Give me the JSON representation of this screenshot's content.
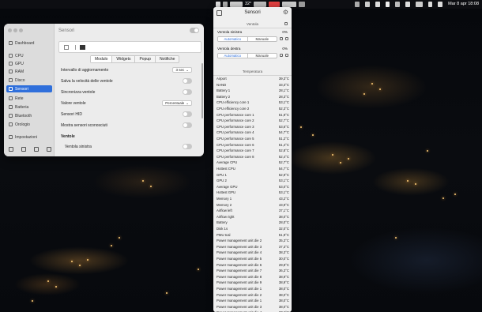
{
  "menubar": {
    "temp": "32°",
    "datetime": "Mar 8 apr  18:08"
  },
  "settings": {
    "sidebar": {
      "items": [
        {
          "label": "Dashboard",
          "icon": "dashboard-icon"
        },
        {
          "label": "CPU",
          "icon": "cpu-icon"
        },
        {
          "label": "GPU",
          "icon": "gpu-icon"
        },
        {
          "label": "RAM",
          "icon": "ram-icon"
        },
        {
          "label": "Disco",
          "icon": "disk-icon"
        },
        {
          "label": "Sensori",
          "icon": "sensor-icon"
        },
        {
          "label": "Rete",
          "icon": "network-icon"
        },
        {
          "label": "Batteria",
          "icon": "battery-icon"
        },
        {
          "label": "Bluetooth",
          "icon": "bluetooth-icon"
        },
        {
          "label": "Orologio",
          "icon": "clock-icon"
        }
      ],
      "active_index": 5,
      "settings_label": "Impostazioni"
    },
    "title": "Sensori",
    "tabs": [
      "Modulo",
      "Widgets",
      "Popup",
      "Notifiche"
    ],
    "active_tab": 0,
    "rows": [
      {
        "label": "Intervallo di aggiornamento",
        "control": "select",
        "value": "3 sec"
      },
      {
        "label": "Salva la velocità delle ventole",
        "control": "toggle"
      },
      {
        "label": "Sincronizza ventole",
        "control": "toggle"
      },
      {
        "label": "Valore ventole",
        "control": "select",
        "value": "Percentuale"
      },
      {
        "label": "Sensori HID",
        "control": "toggle"
      },
      {
        "label": "Mostra sensori sconosciuti",
        "control": "toggle"
      },
      {
        "label": "Ventole",
        "control": "none"
      },
      {
        "label": "Ventola sinistra",
        "control": "toggle"
      }
    ]
  },
  "popup": {
    "title": "Sensori",
    "fan_section": "Ventola",
    "fans": [
      {
        "name": "Ventola sinistra",
        "value": "0%",
        "mode_auto": "Automatico",
        "mode_manual": "Manuale"
      },
      {
        "name": "Ventola destra",
        "value": "0%",
        "mode_auto": "Automatico",
        "mode_manual": "Manuale"
      }
    ],
    "temp_section": "Temperatura",
    "sensors": [
      {
        "name": "Airport",
        "value": "39,3°C"
      },
      {
        "name": "NAND",
        "value": "33,3°C"
      },
      {
        "name": "Battery 1",
        "value": "28,1°C"
      },
      {
        "name": "Battery 2",
        "value": "28,3°C"
      },
      {
        "name": "CPU efficiency core 1",
        "value": "53,1°C"
      },
      {
        "name": "CPU efficiency core 2",
        "value": "52,3°C"
      },
      {
        "name": "CPU performance core 1",
        "value": "51,9°C"
      },
      {
        "name": "CPU performance core 2",
        "value": "52,7°C"
      },
      {
        "name": "CPU performance core 3",
        "value": "53,6°C"
      },
      {
        "name": "CPU performance core 4",
        "value": "54,7°C"
      },
      {
        "name": "CPU performance core 5",
        "value": "51,2°C"
      },
      {
        "name": "CPU performance core 6",
        "value": "51,4°C"
      },
      {
        "name": "CPU performance core 7",
        "value": "52,8°C"
      },
      {
        "name": "CPU performance core 8",
        "value": "52,4°C"
      },
      {
        "name": "Average CPU",
        "value": "52,7°C"
      },
      {
        "name": "Hottest CPU",
        "value": "54,7°C"
      },
      {
        "name": "GPU 1",
        "value": "52,9°C"
      },
      {
        "name": "GPU 2",
        "value": "53,1°C"
      },
      {
        "name": "Average GPU",
        "value": "53,0°C"
      },
      {
        "name": "Hottest GPU",
        "value": "53,1°C"
      },
      {
        "name": "Memory 1",
        "value": "43,2°C"
      },
      {
        "name": "Memory 2",
        "value": "43,9°C"
      },
      {
        "name": "Airflow left",
        "value": "37,1°C"
      },
      {
        "name": "Airflow right",
        "value": "38,0°C"
      },
      {
        "name": "Battery",
        "value": "28,0°C"
      },
      {
        "name": "Disk 1s",
        "value": "32,0°C"
      },
      {
        "name": "PMU tcal",
        "value": "51,9°C"
      },
      {
        "name": "Power management unit die 2",
        "value": "35,3°C"
      },
      {
        "name": "Power management unit die 3",
        "value": "37,3°C"
      },
      {
        "name": "Power management unit die 4",
        "value": "38,3°C"
      },
      {
        "name": "Power management unit die 5",
        "value": "30,0°C"
      },
      {
        "name": "Power management unit die 6",
        "value": "29,8°C"
      },
      {
        "name": "Power management unit die 7",
        "value": "36,3°C"
      },
      {
        "name": "Power management unit die 8",
        "value": "38,9°C"
      },
      {
        "name": "Power management unit die 9",
        "value": "38,9°C"
      },
      {
        "name": "Power management unit die 1",
        "value": "38,0°C"
      },
      {
        "name": "Power management unit die 2",
        "value": "38,0°C"
      },
      {
        "name": "Power management unit die 1​",
        "value": "38,0°C"
      },
      {
        "name": "Power management unit die 3",
        "value": "38,0°C"
      },
      {
        "name": "Power management unit die 4",
        "value": "37,6°C"
      }
    ]
  }
}
